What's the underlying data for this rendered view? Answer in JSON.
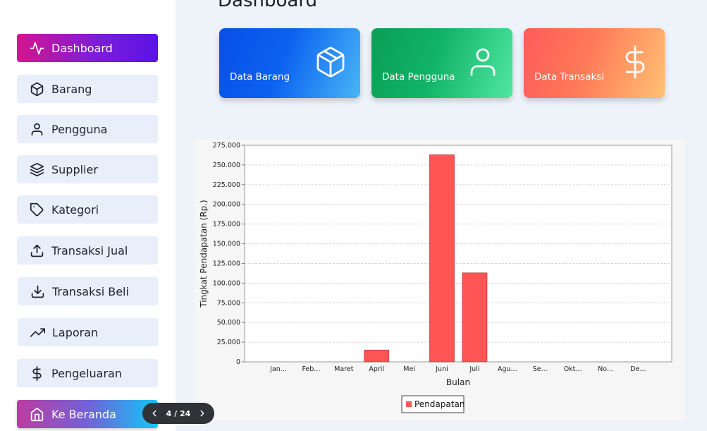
{
  "page_title": "Dashboard",
  "sidebar": {
    "items": [
      {
        "label": "Dashboard",
        "icon": "activity-icon"
      },
      {
        "label": "Barang",
        "icon": "box-icon"
      },
      {
        "label": "Pengguna",
        "icon": "user-icon"
      },
      {
        "label": "Supplier",
        "icon": "layers-icon"
      },
      {
        "label": "Kategori",
        "icon": "tag-icon"
      },
      {
        "label": "Transaksi Jual",
        "icon": "upload-icon"
      },
      {
        "label": "Transaksi Beli",
        "icon": "download-icon"
      },
      {
        "label": "Laporan",
        "icon": "trending-up-icon"
      },
      {
        "label": "Pengeluaran",
        "icon": "dollar-icon"
      }
    ],
    "home_button": {
      "label": "Ke Beranda",
      "icon": "home-icon"
    }
  },
  "cards": [
    {
      "label": "Data Barang",
      "icon": "box-icon"
    },
    {
      "label": "Data Pengguna",
      "icon": "user-icon"
    },
    {
      "label": "Data Transaksi",
      "icon": "dollar-icon"
    }
  ],
  "pager": {
    "text": "4 / 24"
  },
  "chart_data": {
    "type": "bar",
    "categories": [
      "Jan...",
      "Feb...",
      "Maret",
      "April",
      "Mei",
      "Juni",
      "Juli",
      "Agu...",
      "Se...",
      "Okt...",
      "No...",
      "De..."
    ],
    "series": [
      {
        "name": "Pendapatan",
        "values": [
          0,
          0,
          0,
          15000,
          0,
          263000,
          113000,
          0,
          0,
          0,
          0,
          0
        ]
      }
    ],
    "xlabel": "Bulan",
    "ylabel": "Tingkat Pendapatan (Rp.)",
    "ylim": [
      0,
      275000
    ],
    "yticks": [
      "0",
      "25.000",
      "50.000",
      "75.000",
      "100.000",
      "125.000",
      "150.000",
      "175.000",
      "200.000",
      "225.000",
      "250.000",
      "275.000"
    ],
    "grid": true,
    "legend": "bottom-center",
    "bar_color": "#ff5555"
  }
}
